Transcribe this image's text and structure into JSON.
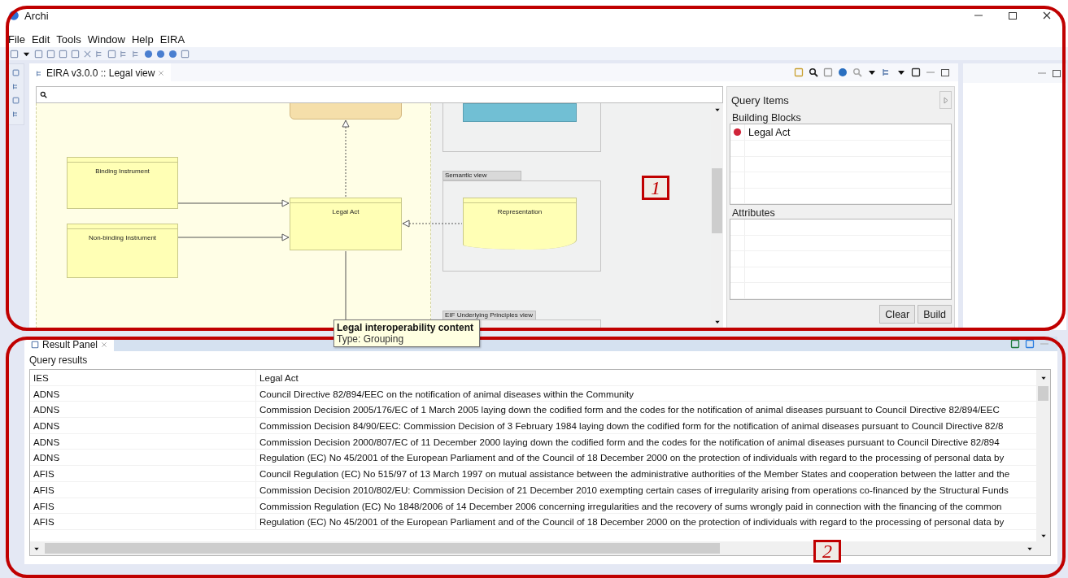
{
  "window": {
    "title": "Archi"
  },
  "menu": [
    "File",
    "Edit",
    "Tools",
    "Window",
    "Help",
    "EIRA"
  ],
  "editor": {
    "tab": {
      "label": "EIRA v3.0.0 :: Legal view",
      "selected": true
    },
    "diagram": {
      "nodes": [
        {
          "kind": "element",
          "label": "Binding Instrument"
        },
        {
          "kind": "element",
          "label": "Non-binding Instrument"
        },
        {
          "kind": "element",
          "label": "Legal Act"
        },
        {
          "kind": "representation",
          "label": "Representation"
        }
      ],
      "views": [
        {
          "label": "Semantic view"
        },
        {
          "label": "EIF Underlying Principles view"
        }
      ]
    },
    "tooltip": {
      "title": "Legal interoperability content",
      "subtitle": "Type: Grouping"
    }
  },
  "query_items": {
    "title": "Query Items",
    "building_blocks": {
      "label": "Building Blocks",
      "items": [
        "Legal Act"
      ]
    },
    "attributes": {
      "label": "Attributes"
    },
    "buttons": [
      "Clear",
      "Build"
    ]
  },
  "result_panel": {
    "tab": {
      "label": "Result Panel",
      "selected": true
    },
    "group": "Query results",
    "columns": [
      "IES",
      "Legal Act"
    ],
    "rows": [
      [
        "ADNS",
        "Council Directive 82/894/EEC on the notification of animal diseases within the Community"
      ],
      [
        "ADNS",
        "Commission Decision 2005/176/EC of 1 March 2005 laying down the codified form and the codes for the notification of animal diseases pursuant to Council Directive 82/894/EEC"
      ],
      [
        "ADNS",
        "Commission Decision 84/90/EEC: Commission Decision of 3 February 1984 laying down the codified form for the notification of animal diseases pursuant to Council Directive 82/8"
      ],
      [
        "ADNS",
        "Commission Decision 2000/807/EC of 11 December 2000 laying down the codified form and the codes for the notification of animal diseases pursuant to Council Directive 82/894"
      ],
      [
        "ADNS",
        "Regulation (EC) No 45/2001 of the European Parliament and of the Council of 18 December 2000 on the protection of individuals with regard to the processing of personal data by"
      ],
      [
        "AFIS",
        "Council Regulation (EC) No 515/97 of 13 March 1997 on mutual assistance between the administrative authorities of the Member States and cooperation between the latter and the"
      ],
      [
        "AFIS",
        "Commission Decision 2010/802/EU: Commission Decision of 21 December 2010 exempting certain cases of irregularity arising from operations co-financed by the Structural Funds"
      ],
      [
        "AFIS",
        "Commission Regulation (EC) No 1848/2006 of 14 December 2006 concerning irregularities and the recovery of sums wrongly paid in connection with the financing of the common"
      ],
      [
        "AFIS",
        "Regulation (EC) No 45/2001 of the European Parliament and of the Council of 18 December 2000 on the protection of individuals with regard to the processing of personal data by"
      ]
    ]
  },
  "callouts": [
    "1",
    "2"
  ]
}
